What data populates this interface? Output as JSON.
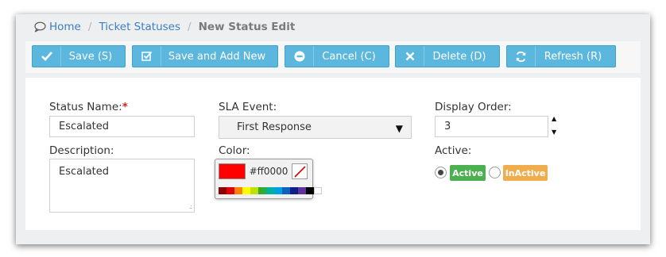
{
  "breadcrumb": {
    "home": "Home",
    "section": "Ticket Statuses",
    "separator": "/",
    "current": "New Status Edit"
  },
  "toolbar": {
    "save": "Save (S)",
    "save_add_new": "Save and Add New",
    "cancel": "Cancel (C)",
    "delete": "Delete (D)",
    "refresh": "Refresh (R)"
  },
  "form": {
    "status_name": {
      "label": "Status Name:",
      "required_mark": "*",
      "value": "Escalated"
    },
    "sla_event": {
      "label": "SLA Event:",
      "value": "First Response"
    },
    "display_order": {
      "label": "Display Order:",
      "value": "3"
    },
    "description": {
      "label": "Description:",
      "value": "Escalated"
    },
    "color": {
      "label": "Color:",
      "value": "#ff0000",
      "palette": [
        "#8b0000",
        "#e00000",
        "#ff7f00",
        "#ffff00",
        "#c0e000",
        "#33aa33",
        "#00b0a0",
        "#00a0e0",
        "#1060c0",
        "#102080",
        "#6030a0",
        "#000000",
        "#ffffff"
      ]
    },
    "active": {
      "label": "Active:",
      "options": [
        {
          "label": "Active",
          "selected": true,
          "color": "#4caf50"
        },
        {
          "label": "InActive",
          "selected": false,
          "color": "#f0ad4e"
        }
      ]
    }
  },
  "colors": {
    "button": "#5bb7dd",
    "link": "#3a7fc0"
  }
}
